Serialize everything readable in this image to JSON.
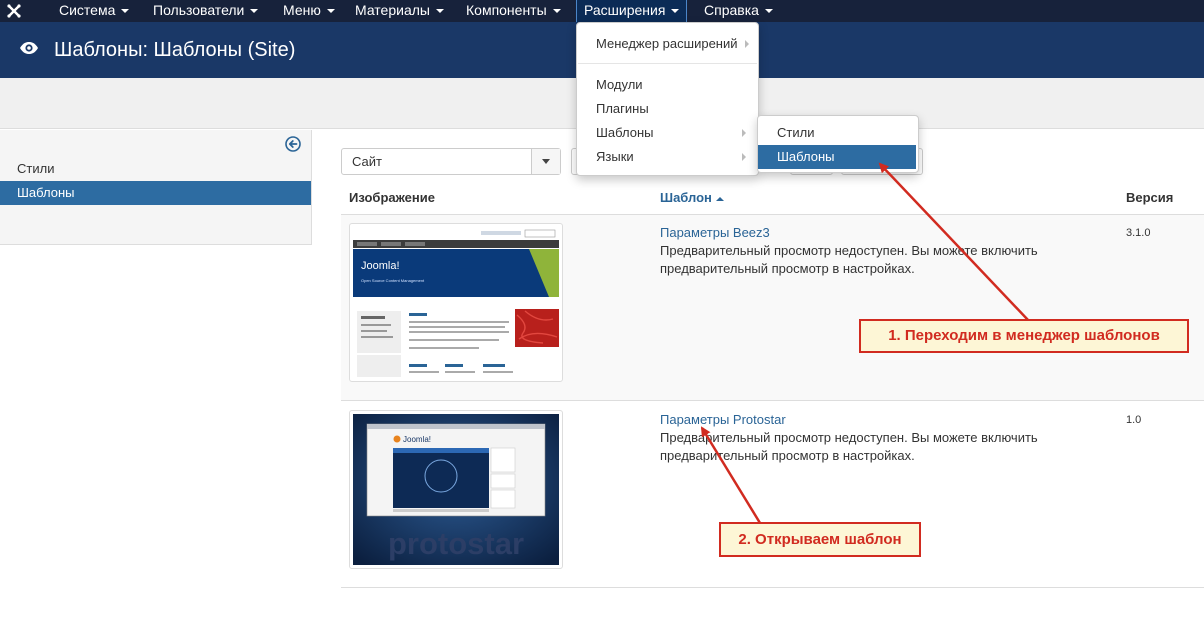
{
  "navbar": {
    "items": [
      {
        "label": "Система"
      },
      {
        "label": "Пользователи"
      },
      {
        "label": "Меню"
      },
      {
        "label": "Материалы"
      },
      {
        "label": "Компоненты"
      },
      {
        "label": "Расширения"
      },
      {
        "label": "Справка"
      }
    ],
    "active": "Расширения"
  },
  "header": {
    "title": "Шаблоны: Шаблоны (Site)"
  },
  "sidebar": {
    "items": [
      {
        "label": "Стили"
      },
      {
        "label": "Шаблоны"
      }
    ],
    "active": "Шаблоны"
  },
  "filter": {
    "client_value": "Сайт"
  },
  "table": {
    "columns": {
      "image": "Изображение",
      "template": "Шаблон",
      "version": "Версия"
    },
    "rows": [
      {
        "name": "Параметры Beez3",
        "description": "Предварительный просмотр недоступен. Вы можете включить предварительный просмотр в настройках.",
        "version": "3.1.0",
        "thumb_text": "Joomla!",
        "thumb_sub": "Open Source Content Management"
      },
      {
        "name": "Параметры Protostar",
        "description": "Предварительный просмотр недоступен. Вы можете включить предварительный просмотр в настройках.",
        "version": "1.0",
        "thumb_text": "protostar",
        "thumb_logo": "Joomla!"
      }
    ]
  },
  "extensions_menu": {
    "items": [
      {
        "label": "Менеджер расширений"
      },
      {
        "label": "Модули"
      },
      {
        "label": "Плагины"
      },
      {
        "label": "Шаблоны"
      },
      {
        "label": "Языки"
      }
    ]
  },
  "templates_submenu": {
    "items": [
      {
        "label": "Стили"
      },
      {
        "label": "Шаблоны"
      }
    ],
    "active": "Шаблоны"
  },
  "annotations": [
    {
      "text": "1. Переходим в менеджер шаблонов"
    },
    {
      "text": "2. Открываем шаблон"
    }
  ],
  "colors": {
    "navbar": "#17223b",
    "header": "#1a3867",
    "active": "#2d6ca2",
    "link": "#2a6496",
    "annotation": "#d12b20",
    "annotation_bg": "#fdf6d6"
  }
}
